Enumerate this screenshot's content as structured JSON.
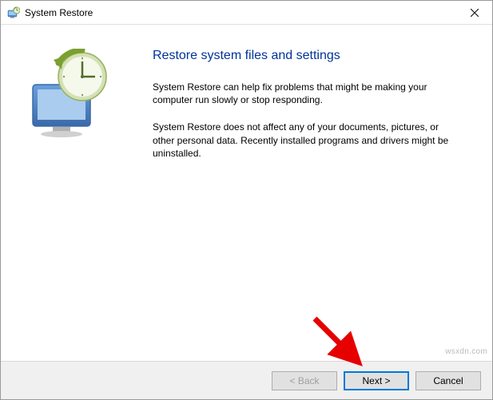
{
  "titlebar": {
    "title": "System Restore"
  },
  "content": {
    "heading": "Restore system files and settings",
    "para1": "System Restore can help fix problems that might be making your computer run slowly or stop responding.",
    "para2": "System Restore does not affect any of your documents, pictures, or other personal data. Recently installed programs and drivers might be uninstalled."
  },
  "buttons": {
    "back": "< Back",
    "next": "Next >",
    "cancel": "Cancel"
  },
  "attribution": "wsxdn.com"
}
